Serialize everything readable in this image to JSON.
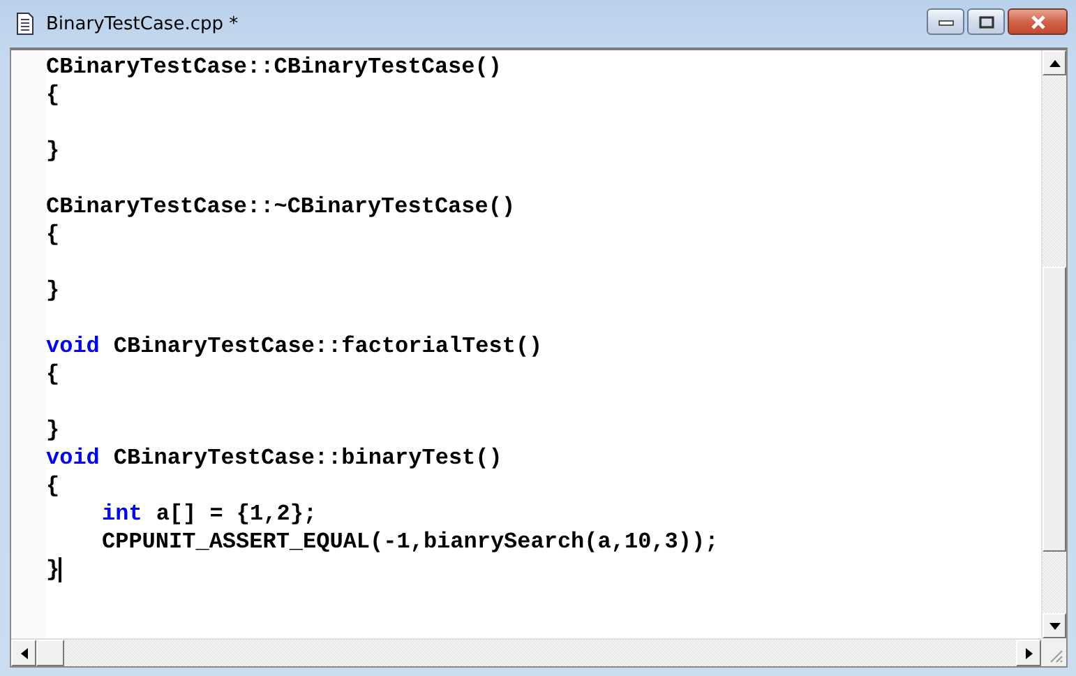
{
  "window": {
    "title": "BinaryTestCase.cpp *"
  },
  "editor": {
    "lines": [
      {
        "kind": "code",
        "indented": false,
        "caret": false,
        "tokens": [
          {
            "text": "CBinaryTestCase::CBinaryTestCase()",
            "kind": "plain"
          }
        ]
      },
      {
        "kind": "code",
        "indented": false,
        "caret": false,
        "tokens": [
          {
            "text": "{",
            "kind": "plain"
          }
        ]
      },
      {
        "kind": "blank"
      },
      {
        "kind": "code",
        "indented": false,
        "caret": false,
        "tokens": [
          {
            "text": "}",
            "kind": "plain"
          }
        ]
      },
      {
        "kind": "blank"
      },
      {
        "kind": "code",
        "indented": false,
        "caret": false,
        "tokens": [
          {
            "text": "CBinaryTestCase::~CBinaryTestCase()",
            "kind": "plain"
          }
        ]
      },
      {
        "kind": "code",
        "indented": false,
        "caret": false,
        "tokens": [
          {
            "text": "{",
            "kind": "plain"
          }
        ]
      },
      {
        "kind": "blank"
      },
      {
        "kind": "code",
        "indented": false,
        "caret": false,
        "tokens": [
          {
            "text": "}",
            "kind": "plain"
          }
        ]
      },
      {
        "kind": "blank"
      },
      {
        "kind": "code",
        "indented": false,
        "caret": false,
        "tokens": [
          {
            "text": "void",
            "kind": "keyword"
          },
          {
            "text": "CBinaryTestCase::factorialTest()",
            "kind": "plain"
          }
        ]
      },
      {
        "kind": "code",
        "indented": false,
        "caret": false,
        "tokens": [
          {
            "text": "{",
            "kind": "plain"
          }
        ]
      },
      {
        "kind": "blank"
      },
      {
        "kind": "code",
        "indented": false,
        "caret": false,
        "tokens": [
          {
            "text": "}",
            "kind": "plain"
          }
        ]
      },
      {
        "kind": "code",
        "indented": false,
        "caret": false,
        "tokens": [
          {
            "text": "void",
            "kind": "keyword"
          },
          {
            "text": "CBinaryTestCase::binaryTest()",
            "kind": "plain"
          }
        ]
      },
      {
        "kind": "code",
        "indented": false,
        "caret": false,
        "tokens": [
          {
            "text": "{",
            "kind": "plain"
          }
        ]
      },
      {
        "kind": "code",
        "indented": true,
        "caret": false,
        "tokens": [
          {
            "text": "int",
            "kind": "keyword"
          },
          {
            "text": "a[] = {1,2};",
            "kind": "plain"
          }
        ]
      },
      {
        "kind": "code",
        "indented": true,
        "caret": false,
        "tokens": [
          {
            "text": "CPPUNIT_ASSERT_EQUAL(-1,bianrySearch(a,10,3));",
            "kind": "plain"
          }
        ]
      },
      {
        "kind": "code",
        "indented": false,
        "caret": true,
        "tokens": [
          {
            "text": "}",
            "kind": "plain"
          }
        ]
      }
    ]
  }
}
